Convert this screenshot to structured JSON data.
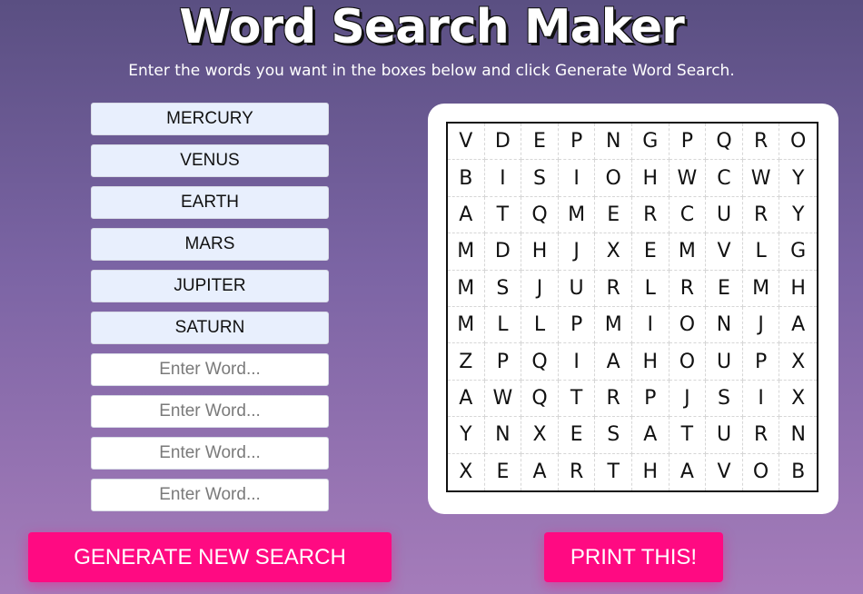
{
  "header": {
    "title": "Word Search Maker",
    "subtitle": "Enter the words you want in the boxes below and click Generate Word Search."
  },
  "inputs": [
    {
      "value": "MERCURY",
      "placeholder": "Enter Word..."
    },
    {
      "value": "VENUS",
      "placeholder": "Enter Word..."
    },
    {
      "value": "EARTH",
      "placeholder": "Enter Word..."
    },
    {
      "value": "MARS",
      "placeholder": "Enter Word..."
    },
    {
      "value": "JUPITER",
      "placeholder": "Enter Word..."
    },
    {
      "value": "SATURN",
      "placeholder": "Enter Word..."
    },
    {
      "value": "",
      "placeholder": "Enter Word..."
    },
    {
      "value": "",
      "placeholder": "Enter Word..."
    },
    {
      "value": "",
      "placeholder": "Enter Word..."
    },
    {
      "value": "",
      "placeholder": "Enter Word..."
    }
  ],
  "grid": [
    [
      "V",
      "D",
      "E",
      "P",
      "N",
      "G",
      "P",
      "Q",
      "R",
      "O"
    ],
    [
      "B",
      "I",
      "S",
      "I",
      "O",
      "H",
      "W",
      "C",
      "W",
      "Y"
    ],
    [
      "A",
      "T",
      "Q",
      "M",
      "E",
      "R",
      "C",
      "U",
      "R",
      "Y"
    ],
    [
      "M",
      "D",
      "H",
      "J",
      "X",
      "E",
      "M",
      "V",
      "L",
      "G"
    ],
    [
      "M",
      "S",
      "J",
      "U",
      "R",
      "L",
      "R",
      "E",
      "M",
      "H"
    ],
    [
      "M",
      "L",
      "L",
      "P",
      "M",
      "I",
      "O",
      "N",
      "J",
      "A"
    ],
    [
      "Z",
      "P",
      "Q",
      "I",
      "A",
      "H",
      "O",
      "U",
      "P",
      "X"
    ],
    [
      "A",
      "W",
      "Q",
      "T",
      "R",
      "P",
      "J",
      "S",
      "I",
      "X"
    ],
    [
      "Y",
      "N",
      "X",
      "E",
      "S",
      "A",
      "T",
      "U",
      "R",
      "N"
    ],
    [
      "X",
      "E",
      "A",
      "R",
      "T",
      "H",
      "A",
      "V",
      "O",
      "B"
    ]
  ],
  "buttons": {
    "generate_label": "GENERATE NEW SEARCH",
    "print_label": "PRINT THIS!"
  },
  "colors": {
    "button_bg": "#ff0a82",
    "filled_input_bg": "#e8effd"
  }
}
